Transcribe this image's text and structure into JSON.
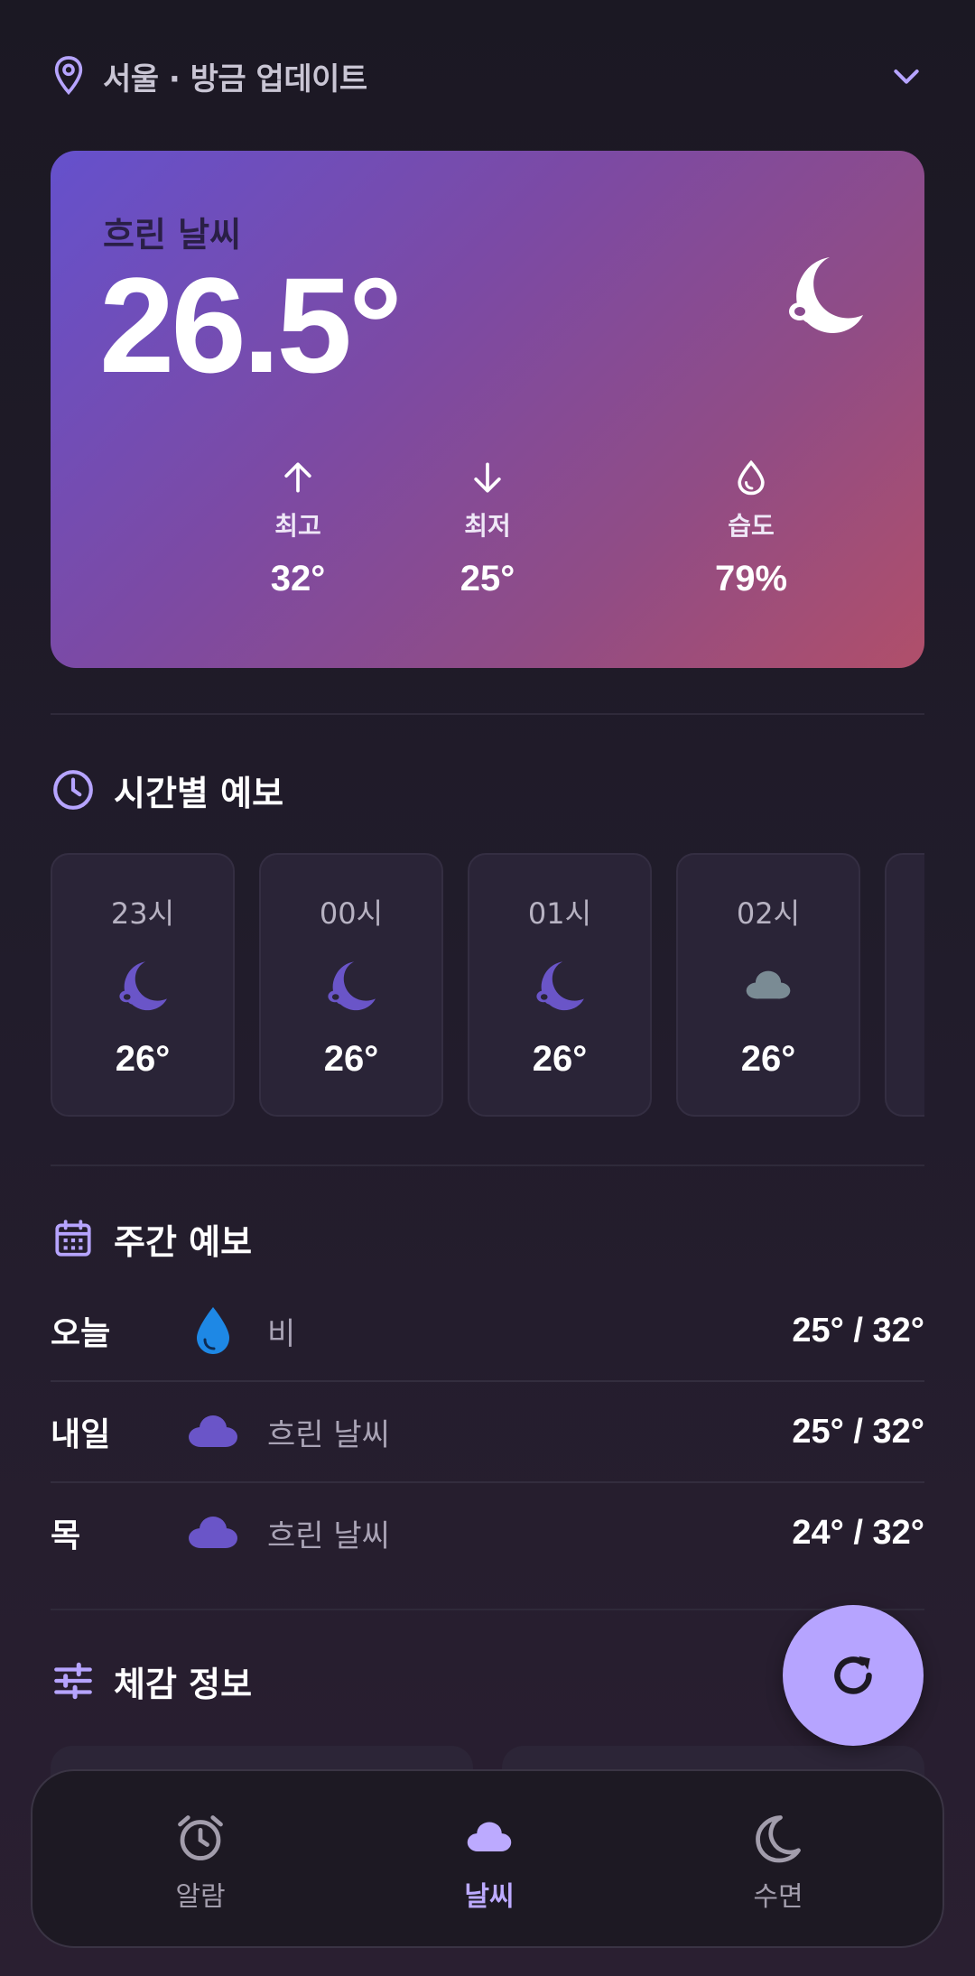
{
  "header": {
    "location": "서울 · 방금 업데이트"
  },
  "current": {
    "condition": "흐린 날씨",
    "temperature": "26.5°",
    "high_label": "최고",
    "high": "32°",
    "low_label": "최저",
    "low": "25°",
    "humidity_label": "습도",
    "humidity": "79%"
  },
  "hourly": {
    "title": "시간별 예보",
    "items": [
      {
        "time": "23시",
        "icon": "moon-cloud-icon",
        "temp": "26°"
      },
      {
        "time": "00시",
        "icon": "moon-cloud-icon",
        "temp": "26°"
      },
      {
        "time": "01시",
        "icon": "moon-cloud-icon",
        "temp": "26°"
      },
      {
        "time": "02시",
        "icon": "cloud-icon",
        "temp": "26°"
      }
    ]
  },
  "weekly": {
    "title": "주간 예보",
    "days": [
      {
        "day": "오늘",
        "icon": "rain-drop-icon",
        "condition": "비",
        "range": "25° / 32°"
      },
      {
        "day": "내일",
        "icon": "cloud-icon",
        "condition": "흐린 날씨",
        "range": "25° / 32°"
      },
      {
        "day": "목",
        "icon": "cloud-icon",
        "condition": "흐린 날씨",
        "range": "24° / 32°"
      }
    ]
  },
  "feels": {
    "title": "체감 정보"
  },
  "nav": {
    "items": [
      {
        "label": "알람",
        "icon": "alarm-clock-icon",
        "active": false
      },
      {
        "label": "날씨",
        "icon": "cloud-icon",
        "active": true
      },
      {
        "label": "수면",
        "icon": "moon-icon",
        "active": false
      }
    ]
  },
  "colors": {
    "accent": "#b6a4ff",
    "hero_start": "#6551cc",
    "hero_end": "#b04f6a",
    "moon_icon": "#6a55c8",
    "rain_icon": "#1e88e5",
    "cloud_icon": "#6a55c8",
    "grey_cloud": "#7a8b94"
  }
}
